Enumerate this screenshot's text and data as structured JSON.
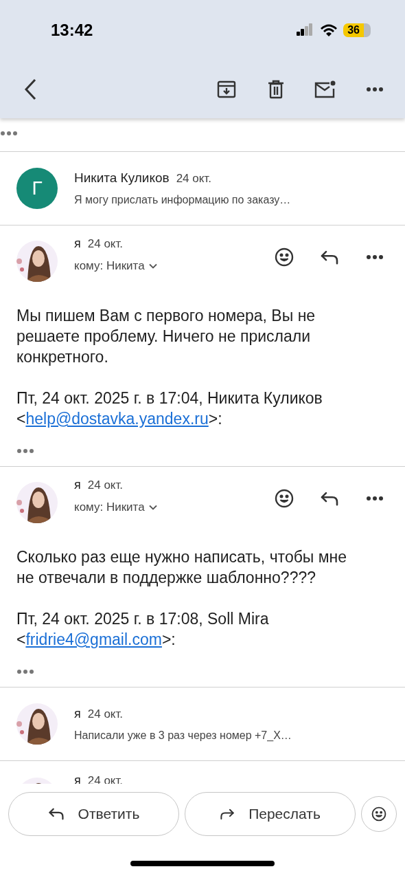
{
  "status_bar": {
    "time": "13:42",
    "battery": "36"
  },
  "messages": [
    {
      "kind": "collapsed",
      "avatar": {
        "kind": "letter",
        "letter": "Г",
        "color": "#168a76"
      },
      "sender": "Никита Куликов",
      "date": "24 окт.",
      "snippet": "Я могу прислать информацию по заказу…"
    },
    {
      "kind": "expanded",
      "sender": "я",
      "date": "24 окт.",
      "recipient": "кому: Никита",
      "body": "Мы пишем Вам с первого номера, Вы не решаете проблему. Ничего не прислали конкретного.",
      "quote_intro": "Пт, 24 окт. 2025 г. в 17:04, Никита Куликов",
      "quote_before": "<",
      "quote_email": "help@dostavka.yandex.ru",
      "quote_after": ">:"
    },
    {
      "kind": "expanded",
      "sender": "я",
      "date": "24 окт.",
      "recipient": "кому: Никита",
      "body": "Сколько раз еще нужно написать, чтобы мне не отвечали в поддержке шаблонно????",
      "quote_intro": "Пт, 24 окт. 2025 г. в 17:08, Soll Mira",
      "quote_before": "<",
      "quote_email": "fridrie4@gmail.com",
      "quote_after": ">:"
    },
    {
      "kind": "collapsed",
      "sender": "я",
      "date": "24 окт.",
      "snippet": "Написали уже в 3 раз через номер +7_X…"
    },
    {
      "kind": "partial",
      "sender": "я",
      "date": "24 окт."
    }
  ],
  "actions": {
    "reply": "Ответить",
    "forward": "Переслать"
  }
}
